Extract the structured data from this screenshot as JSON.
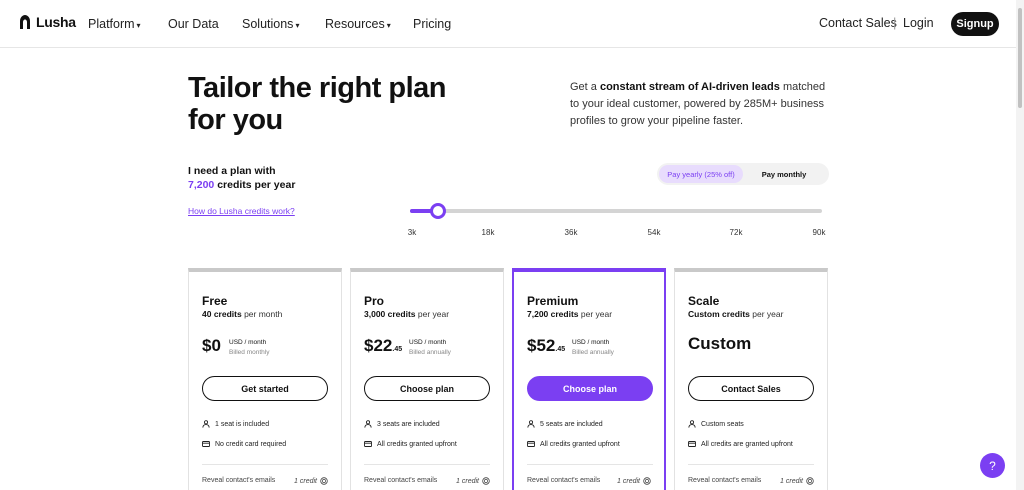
{
  "brand": {
    "name": "Lusha"
  },
  "nav": {
    "items": [
      {
        "label": "Platform",
        "dropdown": true
      },
      {
        "label": "Our Data",
        "dropdown": false
      },
      {
        "label": "Solutions",
        "dropdown": true
      },
      {
        "label": "Resources",
        "dropdown": true
      },
      {
        "label": "Pricing",
        "dropdown": false
      }
    ],
    "contact_sales": "Contact Sales",
    "separator": "|",
    "login": "Login",
    "signup": "Signup"
  },
  "hero": {
    "title": "Tailor the right plan for you",
    "desc_prefix": "Get a ",
    "desc_bold": "constant stream of AI-driven leads",
    "desc_suffix": " matched to your ideal customer, powered by 285M+ business profiles to grow your pipeline faster."
  },
  "plan_selector": {
    "need_label": "I need a plan with",
    "credits_value": "7,200",
    "credits_suffix": "credits per year",
    "how_link": "How do Lusha credits work?",
    "billing": {
      "yearly": "Pay yearly (25% off)",
      "monthly": "Pay monthly",
      "selected": "yearly"
    },
    "slider": {
      "ticks": [
        "3k",
        "18k",
        "36k",
        "54k",
        "72k",
        "90k"
      ],
      "value": 7200,
      "min": 3000,
      "max": 90000
    }
  },
  "plans": [
    {
      "name": "Free",
      "credits_bold": "40 credits",
      "credits_suffix": "per month",
      "price": "$0",
      "cents": "",
      "unit": "USD / month",
      "billing": "Billed monthly",
      "cta": "Get started",
      "features": [
        "1 seat is included",
        "No credit card required"
      ],
      "reveal": "Reveal contact's emails",
      "reveal_credit": "1 credit"
    },
    {
      "name": "Pro",
      "credits_bold": "3,000 credits",
      "credits_suffix": "per year",
      "price": "$22",
      "cents": ".45",
      "unit": "USD / month",
      "billing": "Billed annually",
      "cta": "Choose plan",
      "features": [
        "3 seats are included",
        "All credits granted upfront"
      ],
      "reveal": "Reveal contact's emails",
      "reveal_credit": "1 credit"
    },
    {
      "name": "Premium",
      "credits_bold": "7,200 credits",
      "credits_suffix": "per year",
      "price": "$52",
      "cents": ".45",
      "unit": "USD / month",
      "billing": "Billed annually",
      "cta": "Choose plan",
      "features": [
        "5 seats are included",
        "All credits granted upfront"
      ],
      "reveal": "Reveal contact's emails",
      "reveal_credit": "1 credit"
    },
    {
      "name": "Scale",
      "credits_bold": "Custom credits",
      "credits_suffix": "per year",
      "price": "Custom",
      "cents": "",
      "unit": "",
      "billing": "",
      "cta": "Contact Sales",
      "features": [
        "Custom seats",
        "All credits are granted upfront"
      ],
      "reveal": "Reveal contact's emails",
      "reveal_credit": "1 credit"
    }
  ],
  "help": {
    "label": "?"
  },
  "colors": {
    "accent": "#7b3ff2",
    "dark": "#111111"
  }
}
